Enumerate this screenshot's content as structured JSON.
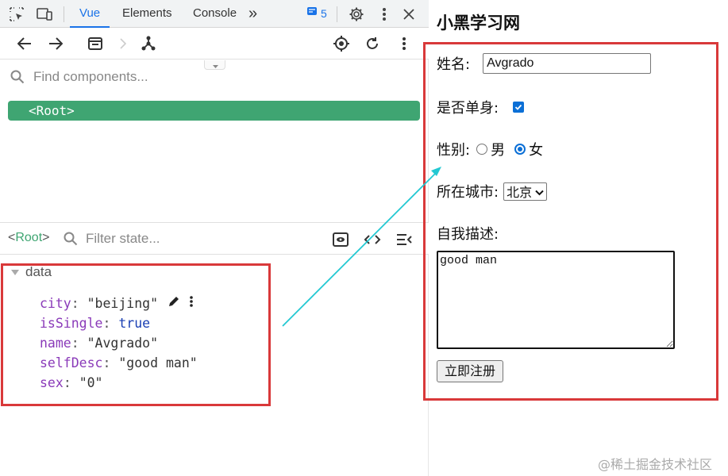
{
  "devtools": {
    "tabs": {
      "vue": "Vue",
      "elements": "Elements",
      "console": "Console",
      "more": "»"
    },
    "issues_count": "5",
    "search_placeholder": "Find components...",
    "root_label": "<Root>",
    "state": {
      "crumb_open": "<",
      "crumb_name": "Root",
      "crumb_close": ">",
      "filter_placeholder": "Filter state..."
    },
    "data_section": "data",
    "properties": [
      {
        "key": "city",
        "value": "\"beijing\"",
        "type": "string"
      },
      {
        "key": "isSingle",
        "value": "true",
        "type": "bool"
      },
      {
        "key": "name",
        "value": "\"Avgrado\"",
        "type": "string"
      },
      {
        "key": "selfDesc",
        "value": "\"good man\"",
        "type": "string"
      },
      {
        "key": "sex",
        "value": "\"0\"",
        "type": "string"
      }
    ],
    "colors": {
      "accent": "#1a73e8",
      "root_bg": "#3fa572",
      "key": "#8a3ab9",
      "bool": "#1a3fb3"
    }
  },
  "page": {
    "title": "小黑学习网",
    "name_label": "姓名:",
    "name_value": "Avgrado",
    "single_label": "是否单身:",
    "single_checked": true,
    "gender_label": "性别:",
    "gender_male": "男",
    "gender_female": "女",
    "gender_selected": "女",
    "city_label": "所在城市:",
    "city_value": "北京",
    "desc_label": "自我描述:",
    "desc_value": "good man",
    "submit_label": "立即注册"
  },
  "annotation": {
    "box_color": "#d9393a",
    "arrow_color": "#22c8d2"
  },
  "watermark": "@稀土掘金技术社区"
}
